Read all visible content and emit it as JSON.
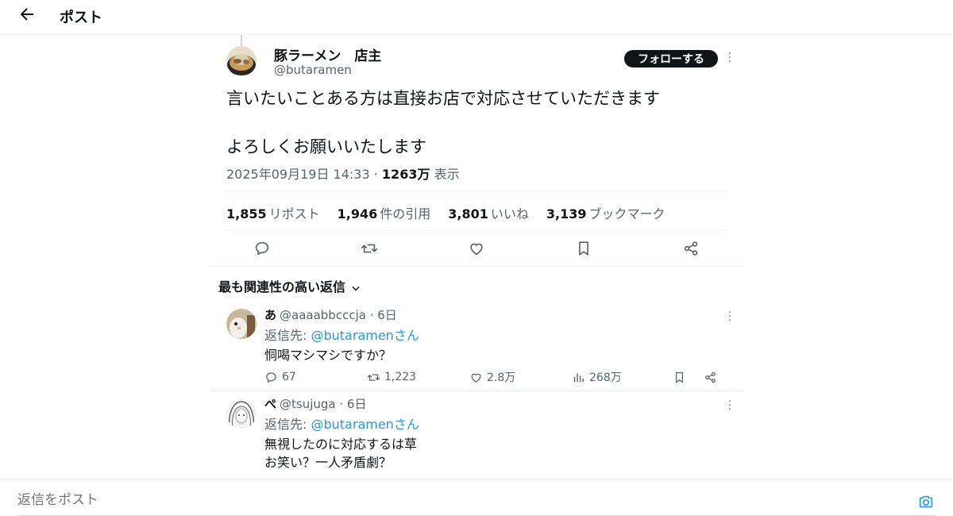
{
  "header": {
    "title": "ポスト"
  },
  "post": {
    "author_name": "豚ラーメン　店主",
    "handle": "@butaramen",
    "follow_label": "フォローする",
    "text_lines": [
      "言いたいことある方は直接お店で対応させていただきます",
      "",
      "よろしくお願いいたします"
    ],
    "timestamp": "2025年09月19日 14:33",
    "views_separator": "·",
    "views_count": "1263万",
    "views_label": "表示",
    "stats": {
      "reposts_count": "1,855",
      "reposts_label": "リポスト",
      "quotes_count": "1,946",
      "quotes_label": "件の引用",
      "likes_count": "3,801",
      "likes_label": "いいね",
      "bookmarks_count": "3,139",
      "bookmarks_label": "ブックマーク"
    }
  },
  "replies_sort": {
    "label": "最も関連性の高い返信"
  },
  "replies": [
    {
      "name": "あ",
      "handle": "@aaaabbcccja",
      "time": "6日",
      "reply_to_prefix": "返信先: ",
      "reply_to_handle": "@butaramenさん",
      "text_lines": [
        "恫喝マシマシですか？"
      ],
      "replies": "67",
      "reposts": "1,223",
      "likes": "2.8万",
      "views": "268万"
    },
    {
      "name": "ぺ",
      "handle": "@tsujuga",
      "time": "6日",
      "reply_to_prefix": "返信先: ",
      "reply_to_handle": "@butaramenさん",
      "text_lines": [
        "無視したのに対応するは草",
        "お笑い？一人矛盾劇？"
      ]
    }
  ],
  "composer": {
    "placeholder": "返信をポスト"
  },
  "colors": {
    "text": "#0f1419",
    "secondary": "#536471",
    "link": "#1d9bf0",
    "border": "#eff3f4",
    "follow_bg": "#0f1419"
  },
  "icons": [
    "back-arrow-icon",
    "more-icon",
    "reply-icon",
    "repost-icon",
    "like-icon",
    "bookmark-icon",
    "share-icon",
    "views-icon",
    "chevron-down-icon",
    "camera-icon"
  ]
}
